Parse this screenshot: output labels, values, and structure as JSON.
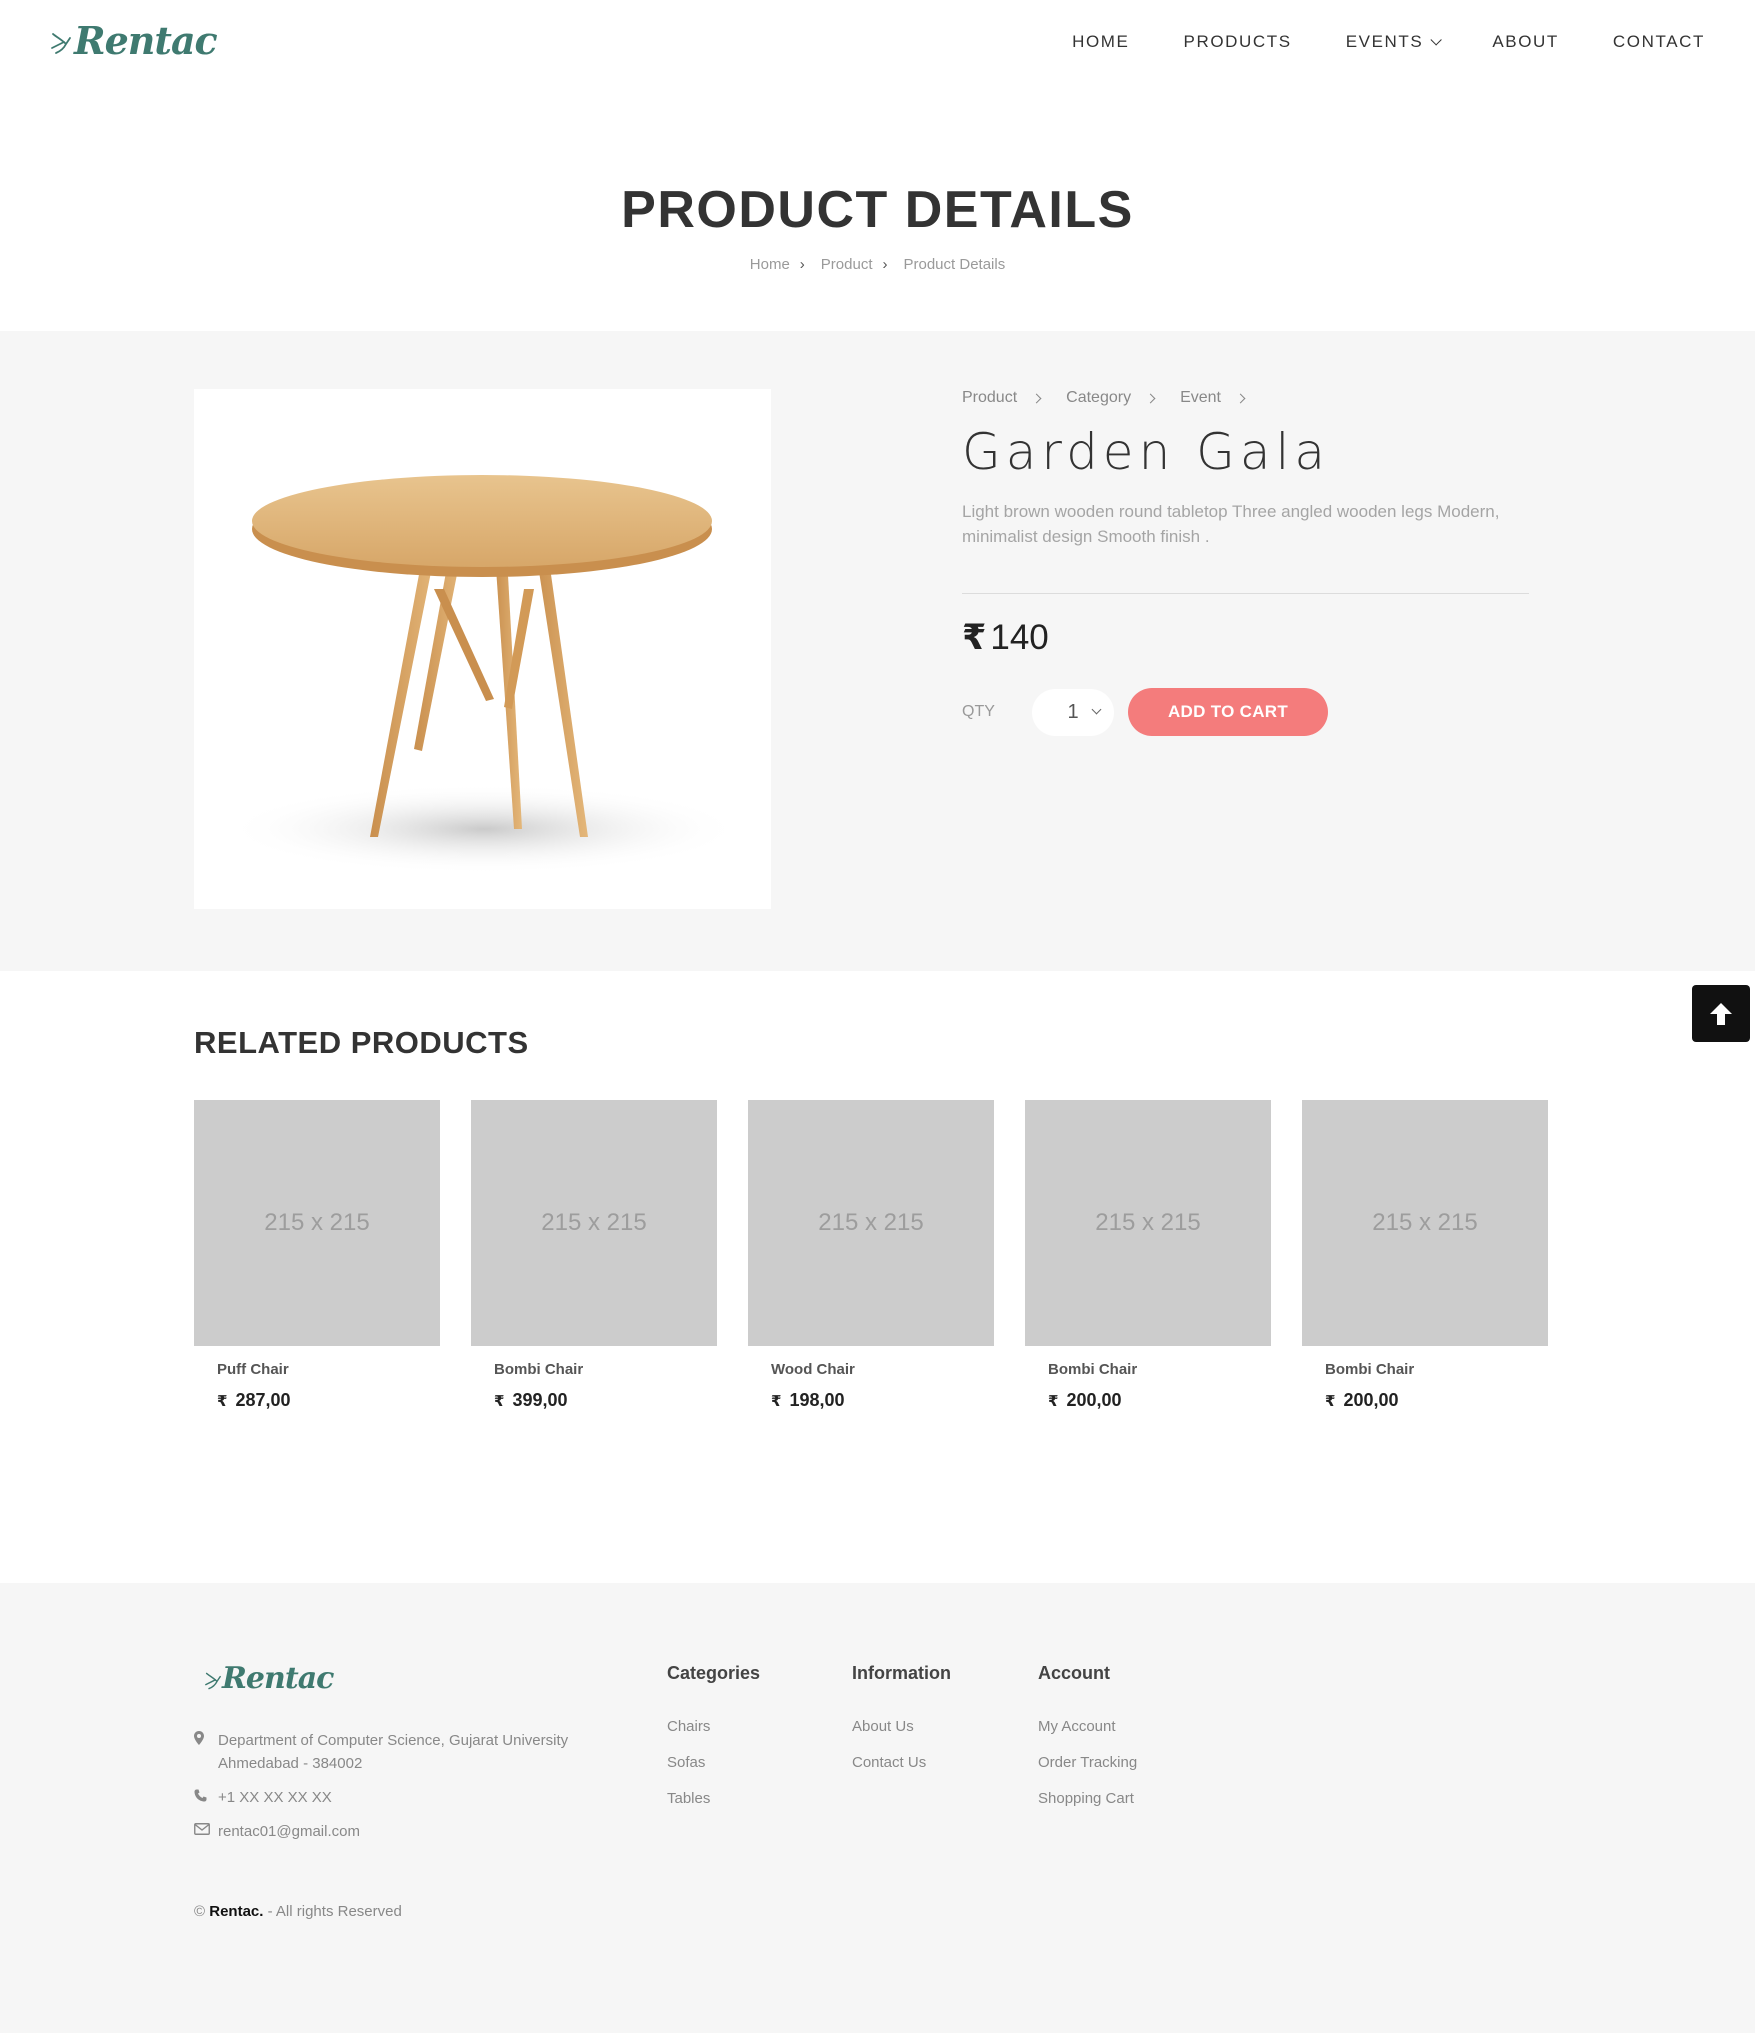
{
  "brand": {
    "name": "Rentac",
    "color": "#3f7a70"
  },
  "nav": {
    "items": [
      {
        "label": "HOME"
      },
      {
        "label": "PRODUCTS"
      },
      {
        "label": "EVENTS"
      },
      {
        "label": "ABOUT"
      },
      {
        "label": "CONTACT"
      }
    ]
  },
  "page": {
    "title": "PRODUCT DETAILS",
    "breadcrumb": [
      "Home",
      "Product",
      "Product Details"
    ]
  },
  "product": {
    "crumbs": [
      "Product",
      "Category",
      "Event"
    ],
    "name": "Garden Gala",
    "description": "Light brown wooden round tabletop Three angled wooden legs Modern, minimalist design Smooth finish .",
    "currency": "₹",
    "price": "140",
    "qty_label": "QTY",
    "qty_value": "1",
    "add_to_cart_label": "ADD TO CART",
    "accent": "#f47c7c"
  },
  "related": {
    "title": "RELATED PRODUCTS",
    "items": [
      {
        "image_text": "215 x 215",
        "name": "Puff Chair",
        "currency": "₹",
        "price": "287,00"
      },
      {
        "image_text": "215 x 215",
        "name": "Bombi Chair",
        "currency": "₹",
        "price": "399,00"
      },
      {
        "image_text": "215 x 215",
        "name": "Wood Chair",
        "currency": "₹",
        "price": "198,00"
      },
      {
        "image_text": "215 x 215",
        "name": "Bombi Chair",
        "currency": "₹",
        "price": "200,00"
      },
      {
        "image_text": "215 x 215",
        "name": "Bombi Chair",
        "currency": "₹",
        "price": "200,00"
      }
    ]
  },
  "footer": {
    "address_line1": "Department of Computer Science, Gujarat University",
    "address_line2": "Ahmedabad - 384002",
    "phone": "+1 XX XX XX XX",
    "email": "rentac01@gmail.com",
    "columns": [
      {
        "title": "Categories",
        "links": [
          "Chairs",
          "Sofas",
          "Tables"
        ]
      },
      {
        "title": "Information",
        "links": [
          "About Us",
          "Contact Us"
        ]
      },
      {
        "title": "Account",
        "links": [
          "My Account",
          "Order Tracking",
          "Shopping Cart"
        ]
      }
    ],
    "copyright_prefix": "©",
    "copyright_brand": "Rentac.",
    "copyright_suffix": "- All rights Reserved"
  },
  "icons": {
    "location": "map-pin-icon",
    "phone": "phone-icon",
    "email": "envelope-icon",
    "scroll_top": "arrow-up-icon",
    "chevron": "chevron-right-icon"
  }
}
